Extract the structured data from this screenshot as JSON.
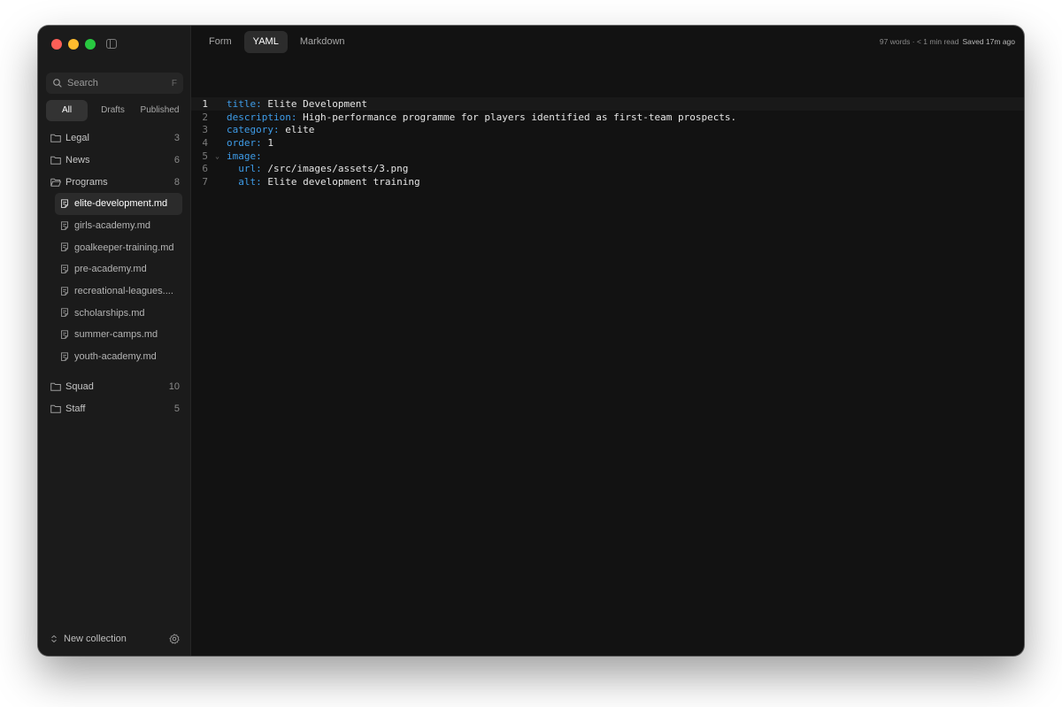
{
  "sidebar": {
    "search": {
      "placeholder": "Search",
      "shortcut": "F"
    },
    "filters": [
      "All",
      "Drafts",
      "Published"
    ],
    "collections": [
      {
        "label": "Legal",
        "count": "3"
      },
      {
        "label": "News",
        "count": "6"
      },
      {
        "label": "Programs",
        "count": "8",
        "expanded": true
      }
    ],
    "files": [
      "elite-development.md",
      "girls-academy.md",
      "goalkeeper-training.md",
      "pre-academy.md",
      "recreational-leagues....",
      "scholarships.md",
      "summer-camps.md",
      "youth-academy.md"
    ],
    "active_file": "elite-development.md",
    "collections_after": [
      {
        "label": "Squad",
        "count": "10"
      },
      {
        "label": "Staff",
        "count": "5"
      }
    ],
    "footer": {
      "new_collection": "New collection"
    }
  },
  "tabs": [
    {
      "label": "Form",
      "active": false
    },
    {
      "label": "YAML",
      "active": true
    },
    {
      "label": "Markdown",
      "active": false
    }
  ],
  "meta": {
    "stats": "97 words · < 1 min read",
    "saved": "Saved 17m ago"
  },
  "editor": {
    "lines": [
      {
        "n": "1",
        "indent": "",
        "key": "title",
        "value": "Elite Development",
        "current": true
      },
      {
        "n": "2",
        "indent": "",
        "key": "description",
        "value": "High-performance programme for players identified as first-team prospects."
      },
      {
        "n": "3",
        "indent": "",
        "key": "category",
        "value": "elite"
      },
      {
        "n": "4",
        "indent": "",
        "key": "order",
        "value": "1"
      },
      {
        "n": "5",
        "indent": "",
        "key": "image",
        "value": "",
        "fold": true
      },
      {
        "n": "6",
        "indent": "  ",
        "key": "url",
        "value": "/src/images/assets/3.png"
      },
      {
        "n": "7",
        "indent": "  ",
        "key": "alt",
        "value": "Elite development training"
      }
    ]
  },
  "colors": {
    "accent_key": "#3e9ce8",
    "background": "#121212",
    "sidebar": "#1b1b1b"
  }
}
